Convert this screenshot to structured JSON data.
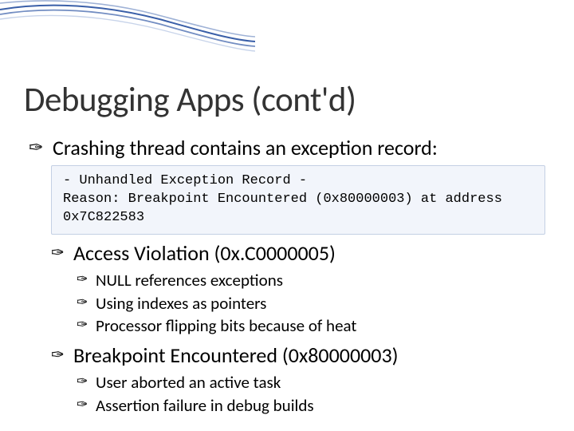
{
  "title": "Debugging Apps (cont'd)",
  "bullets": {
    "0": {
      "text_a": "Crashing",
      "text_b": "thread contains an exception record:"
    },
    "1": {
      "text": "Access Violation (0x.C0000005)"
    },
    "2": {
      "text": "NULL references exceptions"
    },
    "3": {
      "text": "Using indexes as pointers"
    },
    "4": {
      "text": "Processor flipping bits because of heat"
    },
    "5": {
      "text": "Breakpoint Encountered (0x80000003)"
    },
    "6": {
      "text": "User aborted an active task"
    },
    "7": {
      "text": "Assertion failure in debug builds"
    }
  },
  "code": "- Unhandled Exception Record -\nReason: Breakpoint Encountered (0x80000003) at address 0x7C822583"
}
